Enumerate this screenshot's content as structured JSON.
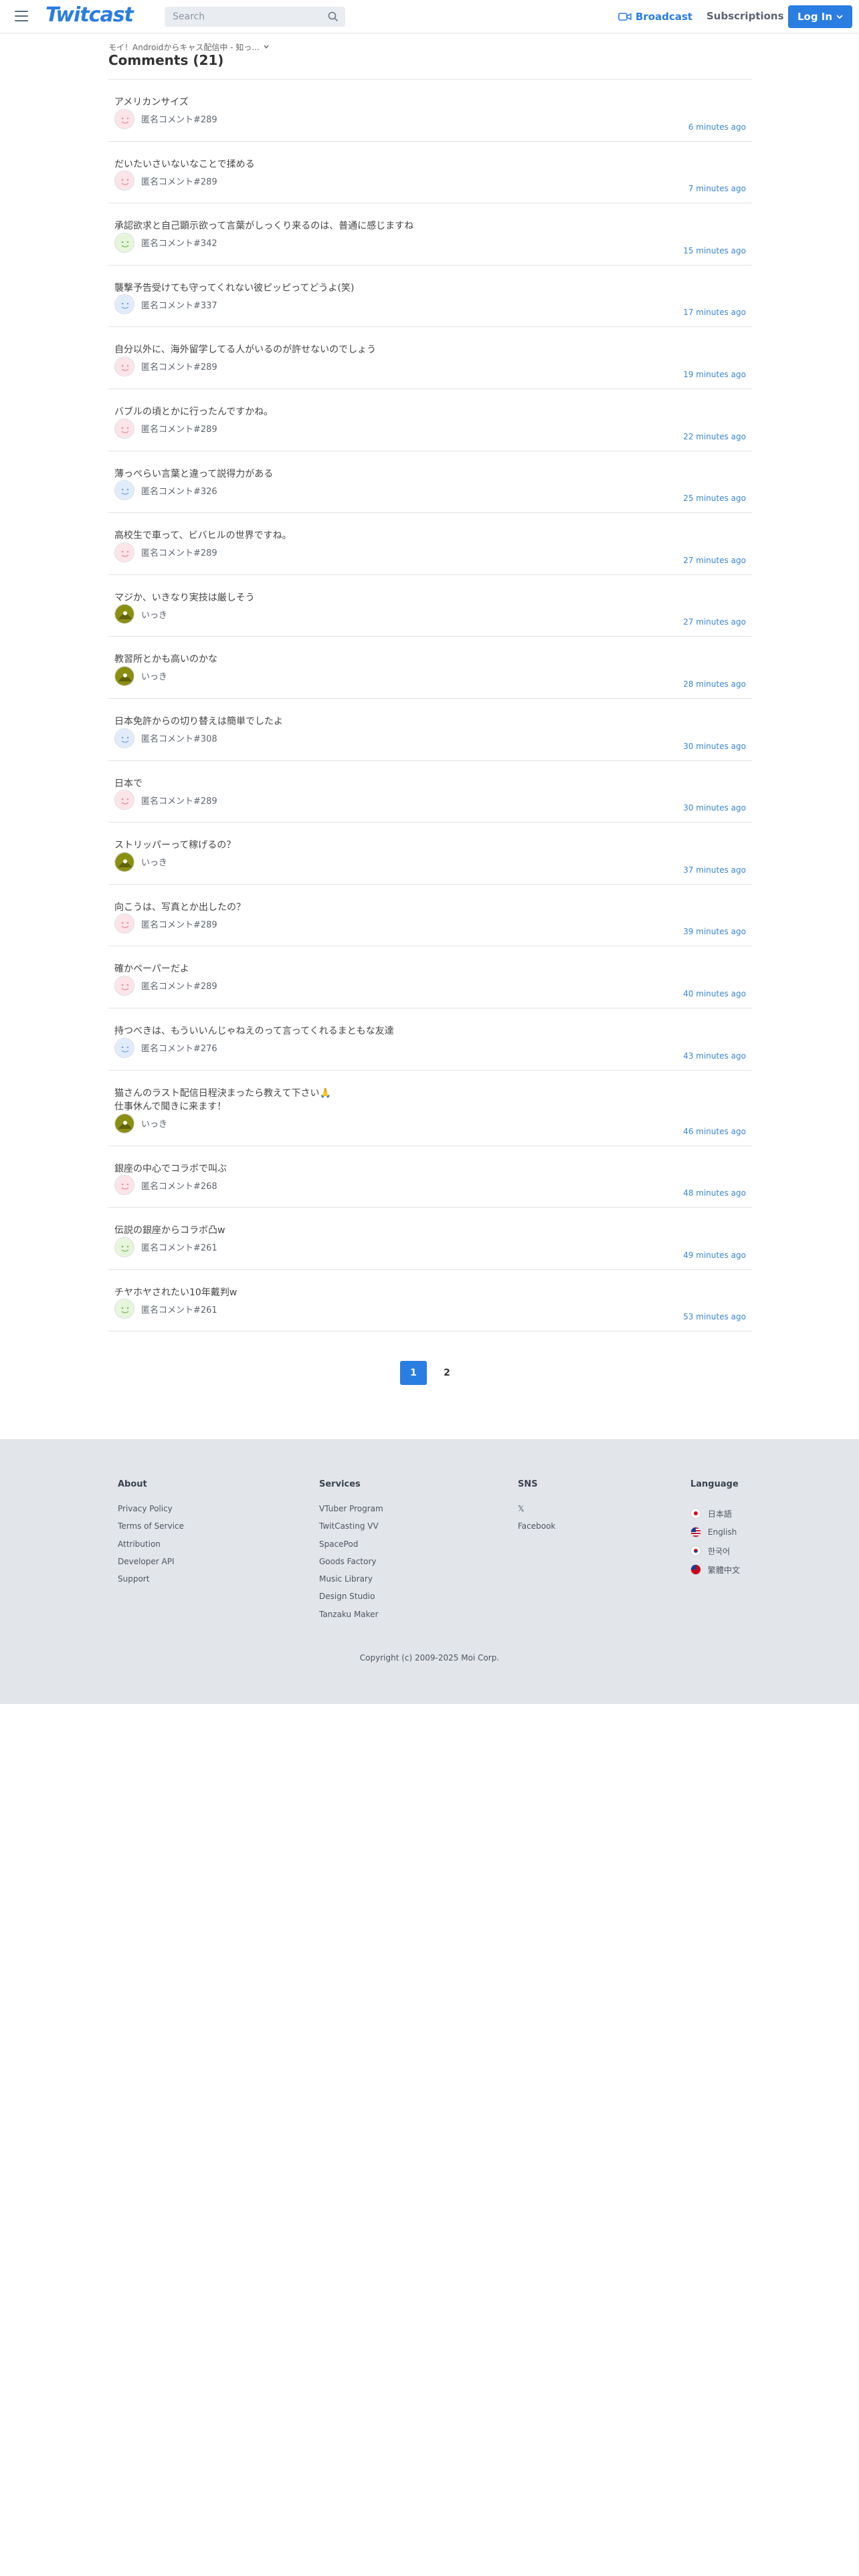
{
  "header": {
    "logo": "Twitcast",
    "search_placeholder": "Search",
    "broadcast_label": "Broadcast",
    "subscriptions_label": "Subscriptions",
    "login_label": "Log In",
    "accent_color": "#2a7de1"
  },
  "breadcrumb": {
    "text": "モイ！Androidからキャス配信中 - 知っ..."
  },
  "page_title": "Comments (21)",
  "comments": [
    {
      "text": "アメリカンサイズ",
      "user": "匿名コメント#289",
      "avatar": "pink",
      "time": "6 minutes ago"
    },
    {
      "text": "だいたいさいないなことで揉める",
      "user": "匿名コメント#289",
      "avatar": "pink",
      "time": "7 minutes ago"
    },
    {
      "text": "承認欲求と自己顕示欲って言葉がしっくり来るのは、普通に感じますね",
      "user": "匿名コメント#342",
      "avatar": "green",
      "time": "15 minutes ago"
    },
    {
      "text": "襲撃予告受けても守ってくれない彼ピッピってどうよ(笑)",
      "user": "匿名コメント#337",
      "avatar": "blue",
      "time": "17 minutes ago"
    },
    {
      "text": "自分以外に、海外留学してる人がいるのが許せないのでしょう",
      "user": "匿名コメント#289",
      "avatar": "pink",
      "time": "19 minutes ago"
    },
    {
      "text": "バブルの頃とかに行ったんですかね。",
      "user": "匿名コメント#289",
      "avatar": "pink",
      "time": "22 minutes ago"
    },
    {
      "text": "薄っぺらい言葉と違って説得力がある",
      "user": "匿名コメント#326",
      "avatar": "blue",
      "time": "25 minutes ago"
    },
    {
      "text": "高校生で車って、ビバヒルの世界ですね。",
      "user": "匿名コメント#289",
      "avatar": "pink",
      "time": "27 minutes ago"
    },
    {
      "text": "マジか、いきなり実技は厳しそう",
      "user": "いっき",
      "avatar": "olive",
      "time": "27 minutes ago"
    },
    {
      "text": "教習所とかも高いのかな",
      "user": "いっき",
      "avatar": "olive",
      "time": "28 minutes ago"
    },
    {
      "text": "日本免許からの切り替えは簡単でしたよ",
      "user": "匿名コメント#308",
      "avatar": "blue",
      "time": "30 minutes ago"
    },
    {
      "text": "日本で",
      "user": "匿名コメント#289",
      "avatar": "pink",
      "time": "30 minutes ago"
    },
    {
      "text": "ストリッパーって稼げるの？",
      "user": "いっき",
      "avatar": "olive",
      "time": "37 minutes ago"
    },
    {
      "text": "向こうは、写真とか出したの？",
      "user": "匿名コメント#289",
      "avatar": "pink",
      "time": "39 minutes ago"
    },
    {
      "text": "確かペーパーだよ",
      "user": "匿名コメント#289",
      "avatar": "pink",
      "time": "40 minutes ago"
    },
    {
      "text": "持つべきは、もういいんじゃねえのって言ってくれるまともな友達",
      "user": "匿名コメント#276",
      "avatar": "blue",
      "time": "43 minutes ago"
    },
    {
      "text": "猫さんのラスト配信日程決まったら教えて下さい🙏\n仕事休んで聞きに来ます！",
      "user": "いっき",
      "avatar": "olive",
      "time": "46 minutes ago"
    },
    {
      "text": "銀座の中心でコラボで叫ぶ",
      "user": "匿名コメント#268",
      "avatar": "pink",
      "time": "48 minutes ago"
    },
    {
      "text": "伝説の銀座からコラボ凸w",
      "user": "匿名コメント#261",
      "avatar": "green",
      "time": "49 minutes ago"
    },
    {
      "text": "チヤホヤされたい10年戴判w",
      "user": "匿名コメント#261",
      "avatar": "green",
      "time": "53 minutes ago"
    }
  ],
  "pagination": {
    "pages": [
      "1",
      "2"
    ],
    "current": "1"
  },
  "footer": {
    "about": {
      "title": "About",
      "links": [
        "Privacy Policy",
        "Terms of Service",
        "Attribution",
        "Developer API",
        "Support"
      ]
    },
    "services": {
      "title": "Services",
      "links": [
        "VTuber Program",
        "TwitCasting VV",
        "SpacePod",
        "Goods Factory",
        "Music Library",
        "Design Studio",
        "Tanzaku Maker"
      ]
    },
    "sns": {
      "title": "SNS",
      "links": [
        "𝕏",
        "Facebook"
      ]
    },
    "language": {
      "title": "Language",
      "items": [
        "日本語",
        "English",
        "한국어",
        "繁體中文"
      ]
    },
    "copyright": "Copyright (c) 2009-2025 Moi Corp."
  }
}
